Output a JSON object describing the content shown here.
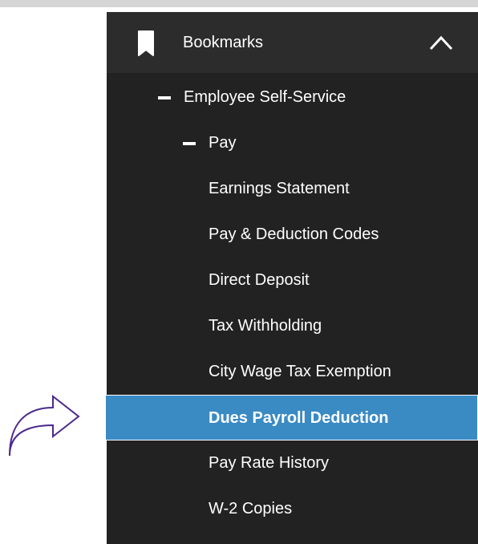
{
  "header": {
    "title": "Bookmarks",
    "icon": "bookmark-icon",
    "toggle_icon": "chevron-up-icon"
  },
  "tree": {
    "group": "Employee Self-Service",
    "subgroup": "Pay",
    "items": [
      "Earnings Statement",
      "Pay & Deduction Codes",
      "Direct Deposit",
      "Tax Withholding",
      "City Wage Tax Exemption",
      "Dues Payroll Deduction",
      "Pay Rate History",
      "W-2 Copies"
    ],
    "selected_index": 5
  },
  "colors": {
    "panel_bg": "#222222",
    "header_bg": "#2c2c2c",
    "selected_bg": "#3a8ac4",
    "arrow": "#4b2a8c",
    "text": "#ffffff"
  }
}
